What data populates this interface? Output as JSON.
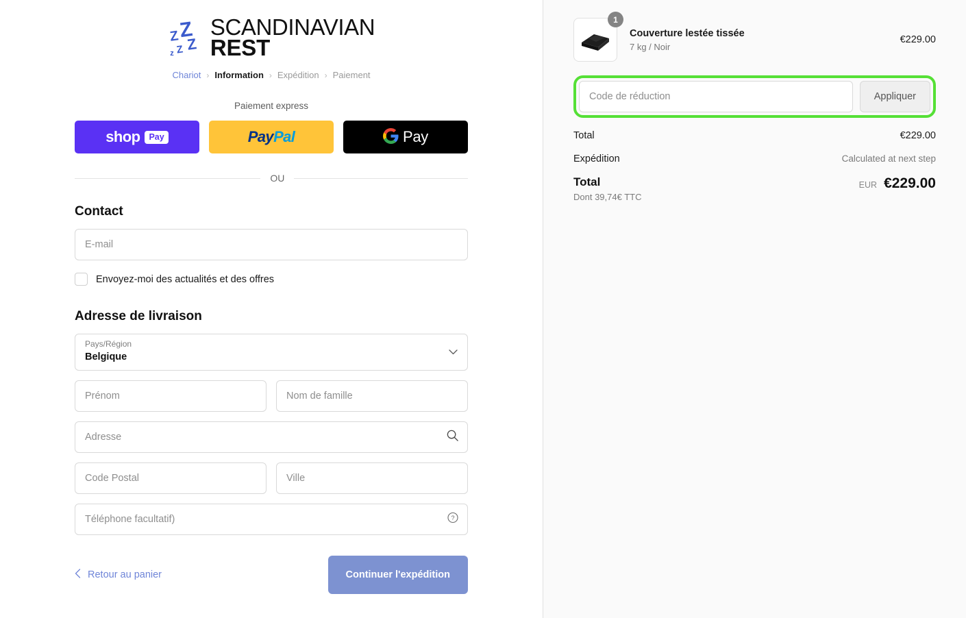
{
  "brand": {
    "logo_icon": "sleep-z-icon",
    "line1": "SCANDINAVIAN",
    "line2": "REST"
  },
  "breadcrumb": {
    "separator": "›",
    "items": [
      {
        "label": "Chariot",
        "state": "link"
      },
      {
        "label": "Information",
        "state": "current"
      },
      {
        "label": "Expédition",
        "state": "upcoming"
      },
      {
        "label": "Paiement",
        "state": "upcoming"
      }
    ]
  },
  "express": {
    "title": "Paiement express",
    "buttons": [
      {
        "name": "shop-pay",
        "word": "shop",
        "badge": "Pay",
        "bg": "#5a31f4"
      },
      {
        "name": "paypal",
        "word_a": "Pay",
        "word_b": "Pal",
        "bg": "#ffc439"
      },
      {
        "name": "google-pay",
        "word": "Pay",
        "bg": "#000000"
      }
    ]
  },
  "divider": {
    "label": "OU"
  },
  "contact": {
    "title": "Contact",
    "email_placeholder": "E-mail",
    "newsletter_label": "Envoyez-moi des actualités et des offres",
    "newsletter_checked": false
  },
  "shipping": {
    "title": "Adresse de livraison",
    "country": {
      "label": "Pays/Région",
      "value": "Belgique"
    },
    "first_name_placeholder": "Prénom",
    "last_name_placeholder": "Nom de famille",
    "address_placeholder": "Adresse",
    "address_icon": "search-icon",
    "postal_placeholder": "Code Postal",
    "city_placeholder": "Ville",
    "phone_placeholder": "Téléphone facultatif)",
    "phone_icon": "help-circle-icon"
  },
  "actions": {
    "back_label": "Retour au panier",
    "back_icon": "chevron-left-icon",
    "continue_label": "Continuer l'expédition",
    "continue_bg": "#7d92d1"
  },
  "summary": {
    "product": {
      "name": "Couverture lestée tissée",
      "variant": "7 kg / Noir",
      "price": "€229.00",
      "quantity": "1",
      "image_icon": "folded-blanket-image"
    },
    "discount": {
      "placeholder": "Code de réduction",
      "apply_label": "Appliquer",
      "highlight_color": "#55e036"
    },
    "lines": [
      {
        "label": "Total",
        "value": "€229.00",
        "muted": false
      },
      {
        "label": "Expédition",
        "value": "Calculated at next step",
        "muted": true
      }
    ],
    "grand": {
      "label": "Total",
      "sub": "Dont 39,74€ TTC",
      "currency": "EUR",
      "amount": "€229.00"
    }
  }
}
